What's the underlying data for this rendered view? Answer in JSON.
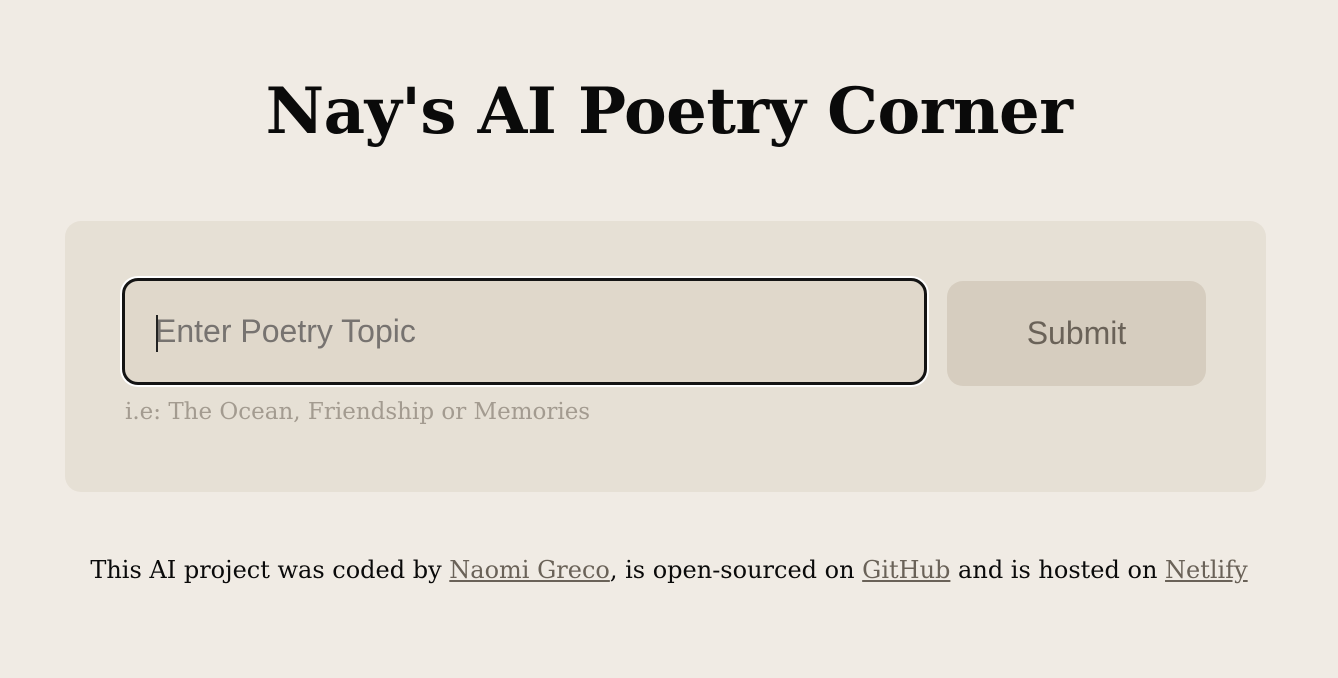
{
  "header": {
    "title": "Nay's AI Poetry Corner"
  },
  "form": {
    "input_placeholder": "Enter Poetry Topic",
    "input_value": "",
    "submit_label": "Submit",
    "hint": "i.e: The Ocean, Friendship or Memories"
  },
  "footer": {
    "text_1": "This AI project was coded by ",
    "author_link": "Naomi Greco",
    "text_2": ", is open-sourced on ",
    "github_link": "GitHub",
    "text_3": " and is hosted on ",
    "netlify_link": "Netlify"
  },
  "colors": {
    "page_background": "#f0ebe4",
    "card_background": "#e6e0d5",
    "input_background": "#e0d8cb",
    "button_background": "#d6cdbf",
    "link": "#6a6258"
  }
}
